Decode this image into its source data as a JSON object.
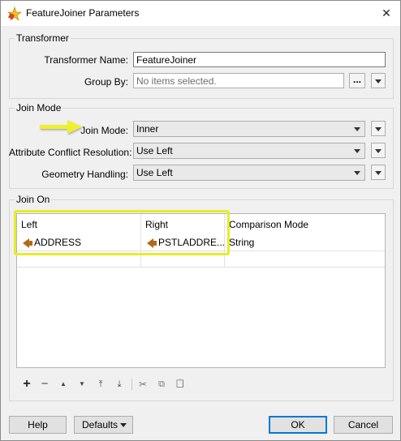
{
  "window": {
    "title": "FeatureJoiner Parameters",
    "close_glyph": "✕"
  },
  "transformer": {
    "legend": "Transformer",
    "name_label": "Transformer Name:",
    "name_value": "FeatureJoiner",
    "group_label": "Group By:",
    "group_placeholder": "No items selected.",
    "ellipsis": "..."
  },
  "join_mode": {
    "legend": "Join Mode",
    "mode_label": "Join Mode:",
    "mode_value": "Inner",
    "conflict_label": "Attribute Conflict Resolution:",
    "conflict_value": "Use Left",
    "geometry_label": "Geometry Handling:",
    "geometry_value": "Use Left"
  },
  "join_on": {
    "legend": "Join On",
    "columns": [
      "Left",
      "Right",
      "Comparison Mode"
    ],
    "rows": [
      {
        "left": "ADDRESS",
        "right": "PSTLADDRE...",
        "mode": "String"
      }
    ],
    "tools": [
      {
        "name": "add-row-icon",
        "glyph": "+"
      },
      {
        "name": "remove-row-icon",
        "glyph": "−"
      },
      {
        "name": "move-up-icon",
        "glyph": "▲"
      },
      {
        "name": "move-down-icon",
        "glyph": "▼"
      },
      {
        "name": "move-top-icon",
        "glyph": "⤒"
      },
      {
        "name": "move-bottom-icon",
        "glyph": "⤓"
      },
      {
        "name": "cut-icon",
        "glyph": "✂"
      },
      {
        "name": "copy-icon",
        "glyph": "⧉"
      },
      {
        "name": "paste-icon",
        "glyph": "📋"
      }
    ]
  },
  "buttons": {
    "help": "Help",
    "defaults": "Defaults",
    "ok": "OK",
    "cancel": "Cancel"
  },
  "colors": {
    "highlight": "#e6ec2a",
    "attribute_icon": "#b36a1e",
    "accent": "#0078d7"
  }
}
